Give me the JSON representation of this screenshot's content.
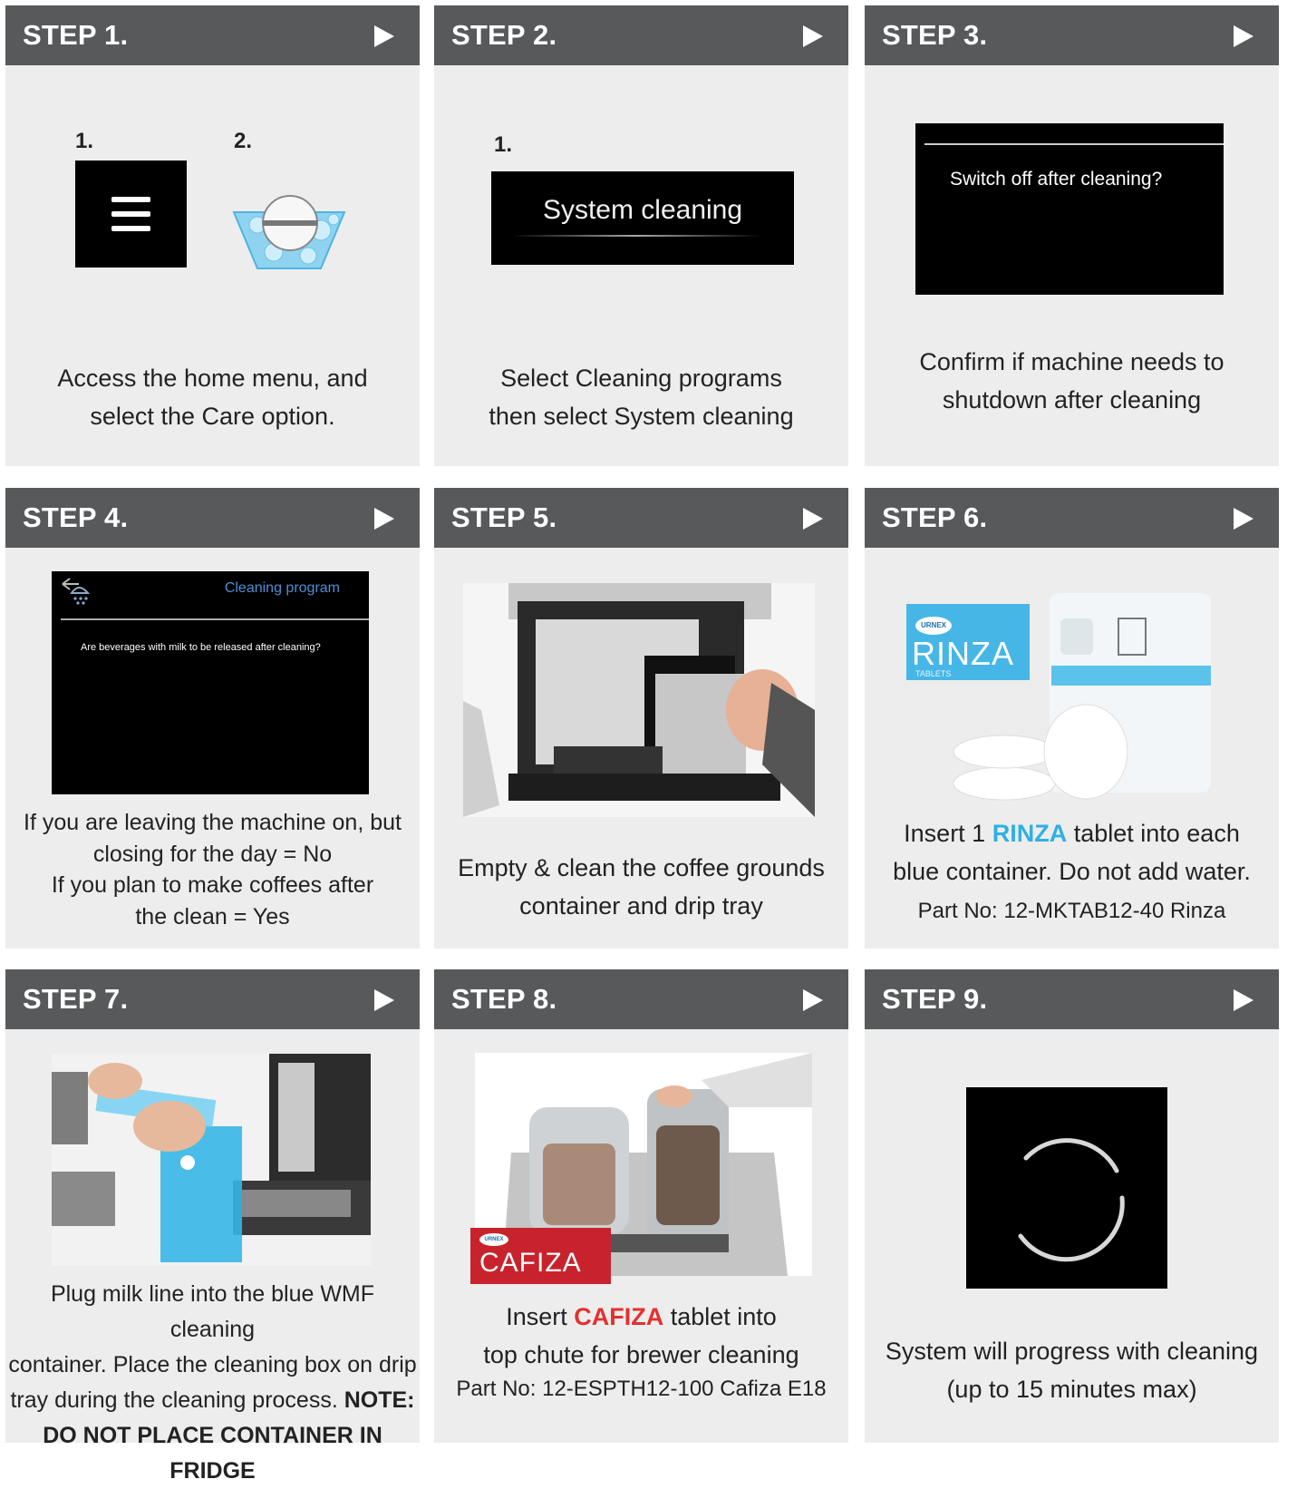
{
  "steps": [
    {
      "title": "STEP 1.",
      "desc_line1": "Access the home menu, and",
      "desc_line2": "select the Care option.",
      "num1": "1.",
      "num2": "2."
    },
    {
      "title": "STEP 2.",
      "desc_line1": "Select Cleaning programs",
      "desc_line2": "then select System cleaning",
      "num1": "1.",
      "screen_text": "System cleaning"
    },
    {
      "title": "STEP 3.",
      "desc_line1": "Confirm if machine needs to",
      "desc_line2": "shutdown after cleaning",
      "screen_text": "Switch off after cleaning?"
    },
    {
      "title": "STEP 4.",
      "desc_line1": "If you are leaving the machine on, but",
      "desc_line2": "closing for the day = No",
      "desc_line3": "If you plan to make coffees after",
      "desc_line4": "the clean = Yes",
      "screen_title": "Cleaning program",
      "screen_text": "Are beverages with milk to be released after cleaning?"
    },
    {
      "title": "STEP 5.",
      "desc_line1": "Empty & clean the coffee grounds",
      "desc_line2": "container and drip tray"
    },
    {
      "title": "STEP 6.",
      "desc_a": "Insert 1 ",
      "desc_brand": "RINZA",
      "desc_b": " tablet into each",
      "desc_line2": "blue container. Do not add water.",
      "part": "Part No: 12-MKTAB12-40 Rinza",
      "box_logo": "URNEX",
      "box_brand": "RINZA",
      "box_sub": "TABLETS"
    },
    {
      "title": "STEP 7.",
      "desc_line1": "Plug milk line into the blue WMF cleaning",
      "desc_line2": "container. Place the cleaning box on drip",
      "desc_line3a": "tray during the cleaning process. ",
      "desc_note": "NOTE:",
      "desc_line4": "DO NOT PLACE CONTAINER IN FRIDGE"
    },
    {
      "title": "STEP 8.",
      "desc_a": "Insert ",
      "desc_brand": "CAFIZA",
      "desc_b": " tablet into",
      "desc_line2": "top chute for brewer cleaning",
      "part": "Part No: 12-ESPTH12-100 Cafiza E18",
      "box_logo": "URNEX",
      "box_brand": "CAFIZA"
    },
    {
      "title": "STEP 9.",
      "desc_line1": "System will progress with cleaning",
      "desc_line2": "(up to 15 minutes max)"
    }
  ],
  "colors": {
    "header": "#58595b",
    "card": "#ededed",
    "rinza_blue": "#30b0e3",
    "cafiza_red": "#e2312f"
  }
}
